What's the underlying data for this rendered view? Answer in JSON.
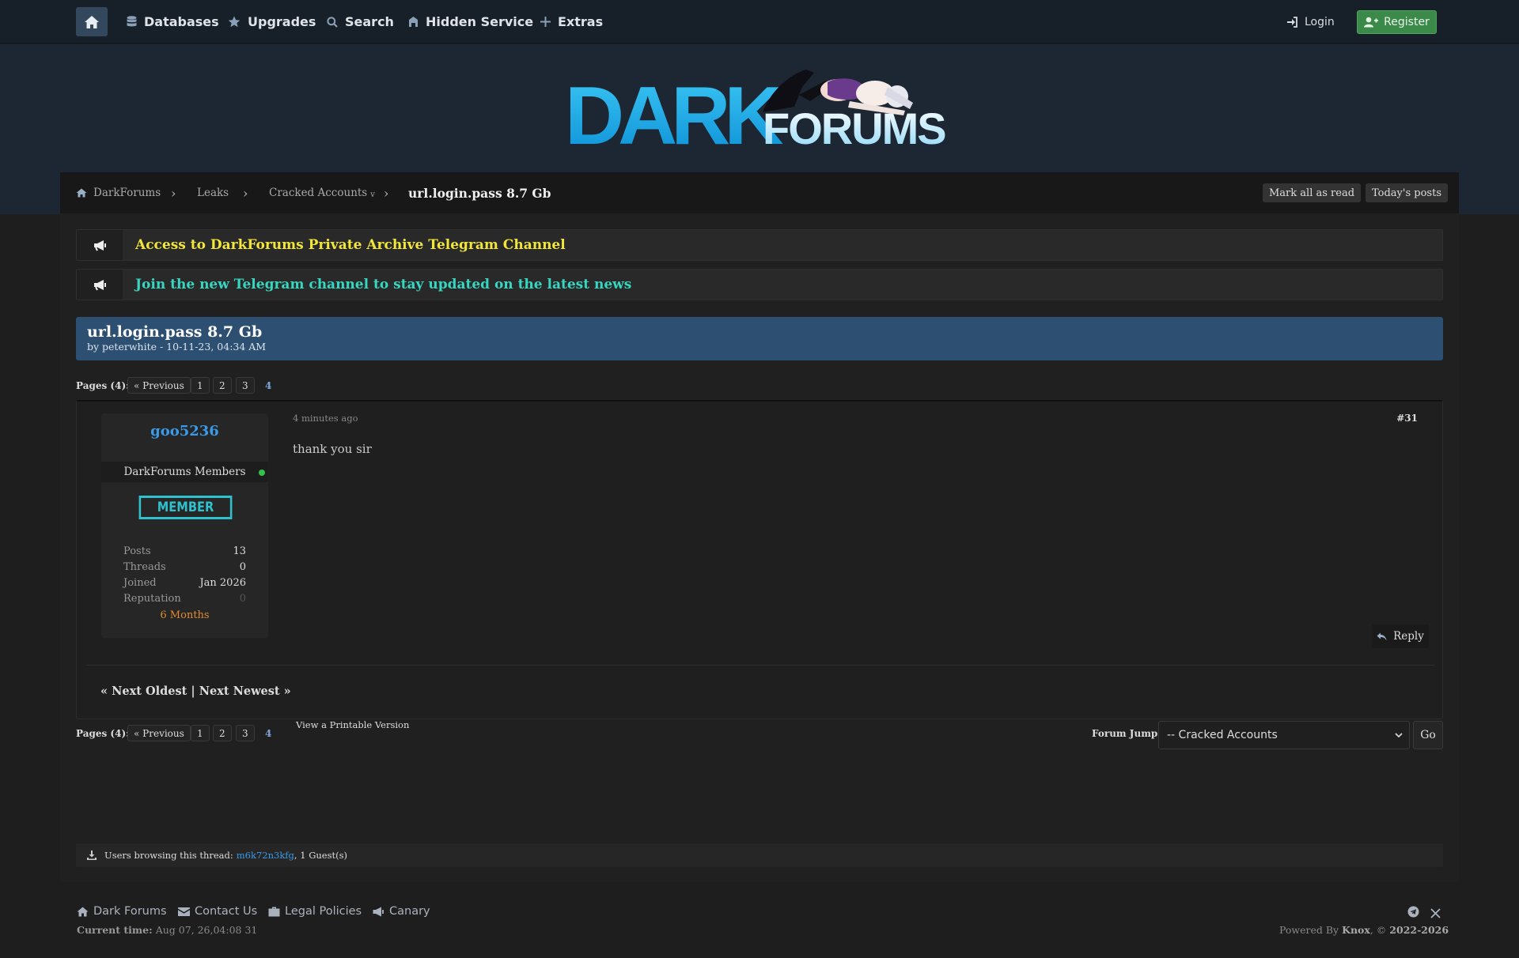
{
  "nav": {
    "items": [
      {
        "label": "Databases",
        "icon": "database-icon"
      },
      {
        "label": "Upgrades",
        "icon": "star-icon"
      },
      {
        "label": "Search",
        "icon": "search-icon"
      },
      {
        "label": "Hidden Service",
        "icon": "hidden-service-icon"
      },
      {
        "label": "Extras",
        "icon": "plus-icon"
      }
    ],
    "login_label": "Login",
    "register_label": "Register"
  },
  "header": {
    "logo_text_dark": "DARK",
    "logo_text_forums": "FORUMS"
  },
  "breadcrumb": {
    "items": [
      "DarkForums",
      "Leaks",
      "Cracked Accounts"
    ],
    "dropdown_marker": "v",
    "current": "url.login.pass 8.7 Gb",
    "mark_all_read": "Mark all as read",
    "todays_posts": "Today's posts"
  },
  "announcements": [
    {
      "text": "Access to DarkForums Private Archive Telegram Channel",
      "color": "#f2e63a"
    },
    {
      "text": "Join the new Telegram channel to stay updated on the latest news",
      "color": "#36d6c0"
    }
  ],
  "thread": {
    "title": "url.login.pass 8.7 Gb",
    "byline": "by peterwhite - 10-11-23, 04:34 AM"
  },
  "pagination": {
    "label": "Pages (4):",
    "previous": "« Previous",
    "pages": [
      "1",
      "2",
      "3"
    ],
    "current": "4"
  },
  "post": {
    "username": "goo5236",
    "group": "DarkForums Members",
    "badge": "MEMBER",
    "stats": [
      {
        "label": "Posts",
        "value": "13"
      },
      {
        "label": "Threads",
        "value": "0"
      },
      {
        "label": "Joined",
        "value": "Jan 2026"
      },
      {
        "label": "Reputation",
        "value": "0"
      }
    ],
    "months": "6 Months",
    "time": "4 minutes ago",
    "number": "#31",
    "body": "thank you sir",
    "reply_label": "Reply"
  },
  "thread_nav": "« Next Oldest | Next Newest »",
  "printable": "View a Printable Version",
  "forum_jump": {
    "label": "Forum Jump:",
    "selected": "-- Cracked Accounts",
    "go": "Go"
  },
  "browsing": {
    "prefix": "Users browsing this thread:",
    "user": "m6k72n3kfg",
    "suffix": ", 1 Guest(s)"
  },
  "footer": {
    "links": [
      "Dark Forums",
      "Contact Us",
      "Legal Policies",
      "Canary"
    ],
    "current_time_label": "Current time:",
    "current_time": "Aug 07, 26,04:08 31",
    "powered_prefix": "Powered By",
    "powered_name": "Knox",
    "copyright_sep": ", ©",
    "copyright_years": "2022-2026"
  },
  "colors": {
    "accent_blue": "#3a9ae8",
    "register_green": "#3c8a4a",
    "thread_header": "#2d4f72",
    "badge_cyan": "#2ec2cf",
    "months_orange": "#e08a2e"
  }
}
